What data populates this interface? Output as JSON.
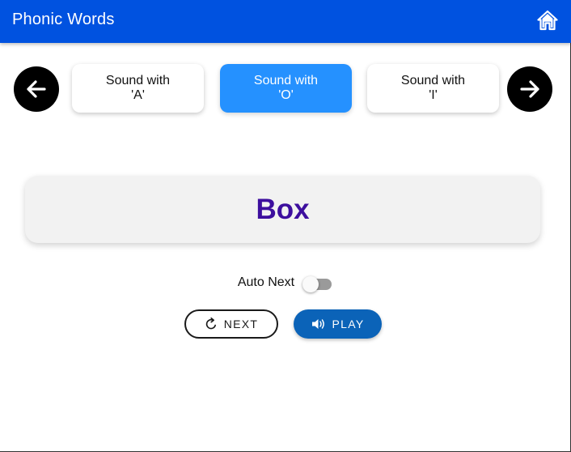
{
  "app": {
    "title": "Phonic Words"
  },
  "header": {
    "home_icon": "home-icon"
  },
  "sound_tabs": [
    {
      "line1": "Sound with",
      "line2": "'A'",
      "active": false
    },
    {
      "line1": "Sound with",
      "line2": "'O'",
      "active": true
    },
    {
      "line1": "Sound with",
      "line2": "'I'",
      "active": false
    }
  ],
  "navigation": {
    "prev_icon": "arrow-left-icon",
    "next_icon": "arrow-right-icon"
  },
  "word_card": {
    "word": "Box"
  },
  "auto_next": {
    "label": "Auto Next",
    "enabled": false
  },
  "controls": {
    "next_label": "NEXT",
    "next_icon": "refresh-icon",
    "play_label": "PLAY",
    "play_icon": "speaker-icon"
  },
  "colors": {
    "topbar": "#0052e0",
    "active_tab": "#2591ff",
    "word_text": "#3d0f9e",
    "play_button": "#0b63b8"
  }
}
